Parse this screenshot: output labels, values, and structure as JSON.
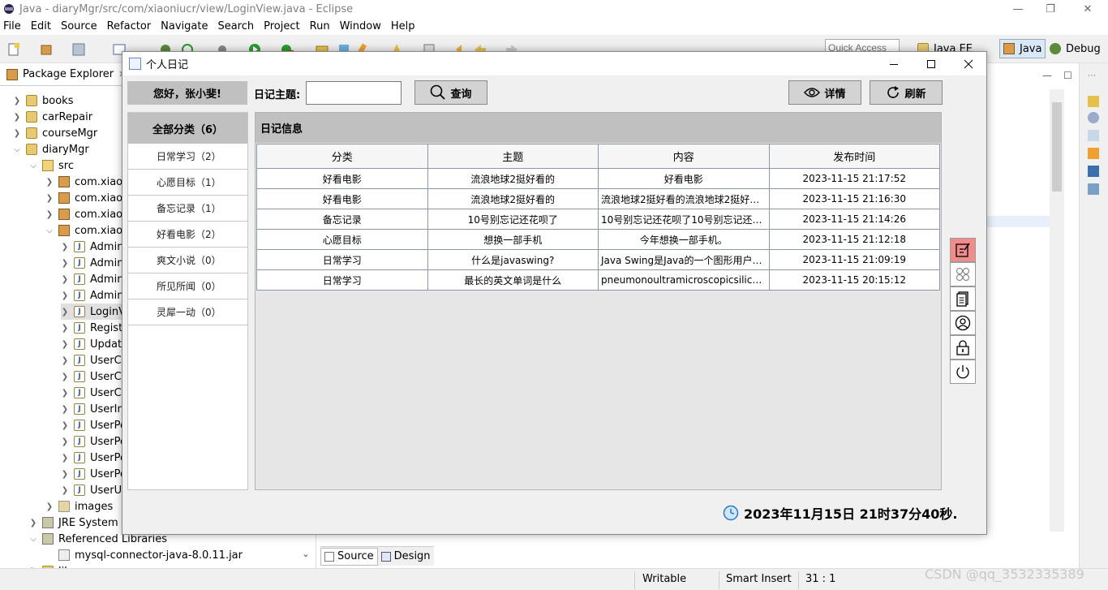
{
  "eclipse": {
    "title": "Java - diaryMgr/src/com/xiaoniucr/view/LoginView.java - Eclipse",
    "menu": [
      "File",
      "Edit",
      "Source",
      "Refactor",
      "Navigate",
      "Search",
      "Project",
      "Run",
      "Window",
      "Help"
    ],
    "quick_access_placeholder": "Quick Access",
    "perspectives": [
      "Java EE",
      "Java",
      "Debug"
    ],
    "package_explorer_title": "Package Explorer",
    "tree": [
      {
        "label": "books"
      },
      {
        "label": "carRepair"
      },
      {
        "label": "courseMgr"
      },
      {
        "label": "diaryMgr"
      },
      {
        "label": "src"
      },
      {
        "label": "com.xiaoni"
      },
      {
        "label": "com.xiaoni"
      },
      {
        "label": "com.xiaoni"
      },
      {
        "label": "com.xiaoni"
      },
      {
        "label": "AdminM"
      },
      {
        "label": "AdminU"
      },
      {
        "label": "AdminU"
      },
      {
        "label": "AdminU"
      },
      {
        "label": "LoginVi"
      },
      {
        "label": "Registe"
      },
      {
        "label": "Update"
      },
      {
        "label": "UserCat"
      },
      {
        "label": "UserCat"
      },
      {
        "label": "UserCat"
      },
      {
        "label": "UserInd"
      },
      {
        "label": "UserPos"
      },
      {
        "label": "UserPos"
      },
      {
        "label": "UserPos"
      },
      {
        "label": "UserPos"
      },
      {
        "label": "UserUp"
      },
      {
        "label": "images"
      },
      {
        "label": "JRE System Lib"
      },
      {
        "label": "Referenced Libraries"
      },
      {
        "label": "mysql-connector-java-8.0.11.jar"
      },
      {
        "label": "lib"
      }
    ],
    "editor_tabs": [
      "Source",
      "Design"
    ],
    "status": {
      "writable": "Writable",
      "insert": "Smart Insert",
      "position": "31 : 1"
    },
    "watermark": "CSDN @qq_3532335389"
  },
  "app": {
    "title": "个人日记",
    "greeting": "您好，张小斐!",
    "search_label": "日记主题:",
    "search_value": "",
    "buttons": {
      "query": "查询",
      "detail": "详情",
      "refresh": "刷新"
    },
    "categories_all": "全部分类（6）",
    "categories": [
      "日常学习（2）",
      "心愿目标（1）",
      "备忘记录（1）",
      "好看电影（2）",
      "爽文小说（0）",
      "所见所闻（0）",
      "灵犀一动（0）"
    ],
    "panel_title": "日记信息",
    "columns": [
      "分类",
      "主题",
      "内容",
      "发布时间"
    ],
    "rows": [
      [
        "好看电影",
        "流浪地球2挺好看的",
        "好看电影",
        "2023-11-15 21:17:52"
      ],
      [
        "好看电影",
        "流浪地球2挺好看的",
        "流浪地球2挺好看的流浪地球2挺好看...",
        "2023-11-15 21:16:30"
      ],
      [
        "备忘记录",
        "10号别忘记还花呗了",
        "10号别忘记还花呗了10号别忘记还花...",
        "2023-11-15 21:14:26"
      ],
      [
        "心愿目标",
        "想换一部手机",
        "今年想换一部手机。",
        "2023-11-15 21:12:18"
      ],
      [
        "日常学习",
        "什么是javaswing?",
        "Java Swing是Java的一个图形用户界...",
        "2023-11-15 21:09:19"
      ],
      [
        "日常学习",
        "最长的英文单词是什么",
        "pneumonoultramicroscopicsilicovol...",
        "2023-11-15 20:15:12"
      ]
    ],
    "side_icons": [
      "edit-icon",
      "clover-icon",
      "document-icon",
      "user-icon",
      "lock-icon",
      "power-icon"
    ],
    "clock": "2023年11月15日 21时37分40秒."
  }
}
